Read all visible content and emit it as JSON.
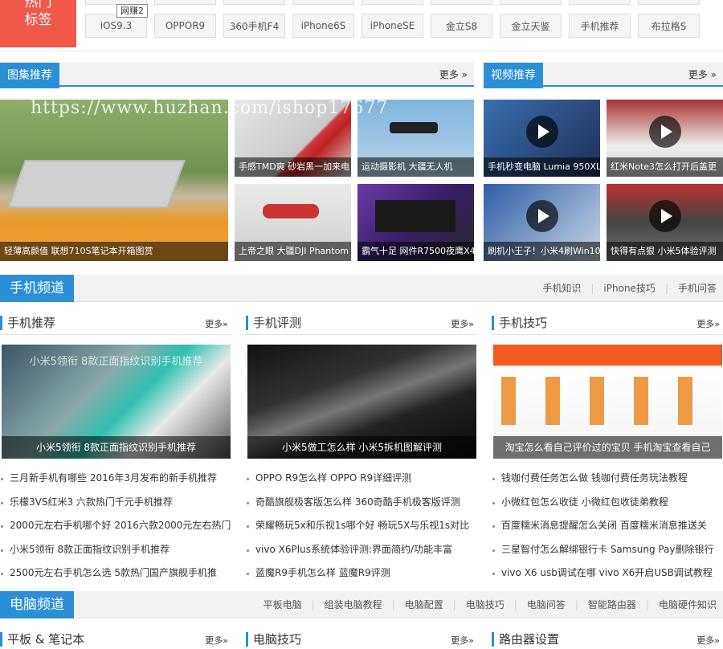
{
  "hot_tags": {
    "label_line1": "热门",
    "label_line2": "标签",
    "tooltip": "网赚2",
    "tags": [
      "iOS9.3",
      "OPPOR9",
      "360手机F4",
      "iPhone6S",
      "iPhoneSE",
      "金立S8",
      "金立天鉴",
      "手机推荐",
      "布拉格S"
    ]
  },
  "watermark": "https://www.huzhan.com/ishop17677",
  "gallery": {
    "title": "图集推荐",
    "more": "更多 »",
    "items": [
      "轻薄高颜值 联想710S笔记本开箱图赏",
      "手感TMD爽 砂岩黑一加来电",
      "运动摄影机 大疆无人机",
      "上帝之眼 大疆DJI Phantom",
      "霸气十足 网件R7500夜鹰X4"
    ]
  },
  "video": {
    "title": "视频推荐",
    "more": "更多 »",
    "items": [
      "手机秒变电脑 Lumia 950XL",
      "红米Note3怎么打开后盖更",
      "刷机小王子！小米4刷Win10",
      "快得有点狠 小米5体验评测"
    ]
  },
  "phone_channel": {
    "title": "手机频道",
    "links": [
      "手机知识",
      "iPhone技巧",
      "手机问答"
    ],
    "columns": [
      {
        "title": "手机推荐",
        "more": "更多»",
        "overlay": "小米5领衔 8款正面指纹识别手机推荐",
        "caption": "小米5领衔 8款正面指纹识别手机推荐",
        "news": [
          "三月新手机有哪些 2016年3月发布的新手机推荐",
          "乐檬3VS红米3 六款热门千元手机推荐",
          "2000元左右手机哪个好 2016六款2000元左右热门",
          "小米5领衔 8款正面指纹识别手机推荐",
          "2500元左右手机怎么选 5款热门国产旗舰手机推"
        ]
      },
      {
        "title": "手机评测",
        "more": "更多»",
        "overlay": "",
        "caption": "小米5做工怎么样 小米5拆机图解评测",
        "news": [
          "OPPO R9怎么样 OPPO R9详细评测",
          "奇酷旗舰极客版怎么样 360奇酷手机极客版评测",
          "荣耀畅玩5x和乐视1s哪个好 畅玩5X与乐视1s对比",
          "vivo X6Plus系统体验评测:界面简约/功能丰富",
          "蓝魔R9手机怎么样 蓝魔R9评测"
        ]
      },
      {
        "title": "手机技巧",
        "more": "更多»",
        "overlay": "",
        "caption": "淘宝怎么看自己评价过的宝贝 手机淘宝查看自己",
        "news": [
          "钱咖付费任务怎么做 钱咖付费任务玩法教程",
          "小微红包怎么收徒 小微红包收徒弟教程",
          "百度糯米消息提醒怎么关闭 百度糯米消息推送关",
          "三星智付怎么解绑银行卡 Samsung Pay删除银行",
          "vivo X6 usb调试在哪 vivo X6开启USB调试教程"
        ]
      }
    ]
  },
  "pc_channel": {
    "title": "电脑频道",
    "links": [
      "平板电脑",
      "组装电脑教程",
      "电脑配置",
      "电脑技巧",
      "电脑问答",
      "智能路由器",
      "电脑硬件知识"
    ],
    "columns": [
      {
        "title": "平板 & 笔记本",
        "more": "更多»"
      },
      {
        "title": "电脑技巧",
        "more": "更多»"
      },
      {
        "title": "路由器设置",
        "more": "更多»"
      }
    ]
  },
  "colors": {
    "accent": "#2a8fd6",
    "hot": "#f0584a"
  }
}
